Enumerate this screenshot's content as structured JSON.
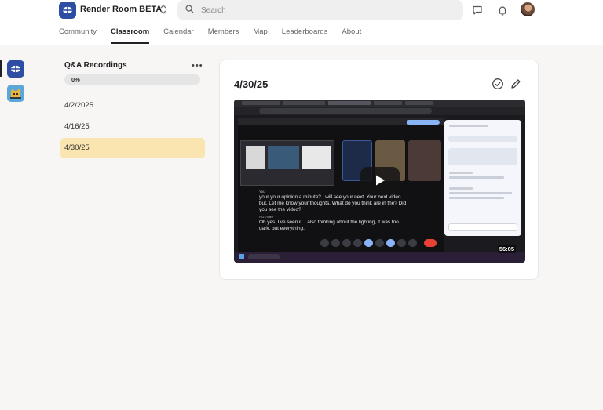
{
  "app": {
    "title": "Render Room BETA",
    "brand_color": "#2e4ea3"
  },
  "search": {
    "placeholder": "Search"
  },
  "nav": {
    "tabs": [
      {
        "label": "Community",
        "active": false
      },
      {
        "label": "Classroom",
        "active": true
      },
      {
        "label": "Calendar",
        "active": false
      },
      {
        "label": "Members",
        "active": false
      },
      {
        "label": "Map",
        "active": false
      },
      {
        "label": "Leaderboards",
        "active": false
      },
      {
        "label": "About",
        "active": false
      }
    ]
  },
  "header_icons": [
    "chat-icon",
    "bell-icon",
    "avatar"
  ],
  "module": {
    "title": "Q&A Recordings",
    "progress_label": "0%",
    "progress": 0,
    "lessons": [
      {
        "label": "4/2/2025",
        "active": false
      },
      {
        "label": "4/16/25",
        "active": false
      },
      {
        "label": "4/30/25",
        "active": true
      }
    ],
    "active_color": "#fae4b0"
  },
  "lesson": {
    "title": "4/30/25",
    "video": {
      "duration": "56:05",
      "caption_speaker_1": "You",
      "caption_1": [
        "your your opinion a minute? I will see your next. Your next video.",
        "but, Let me know your thoughts. What do you think are in the? Did",
        "you see the video?"
      ],
      "caption_speaker_2": "AG 7899",
      "caption_2": [
        "Oh yes, I've seen it. I also thinking about the lighting, it was too",
        "dark, but everything."
      ]
    }
  }
}
